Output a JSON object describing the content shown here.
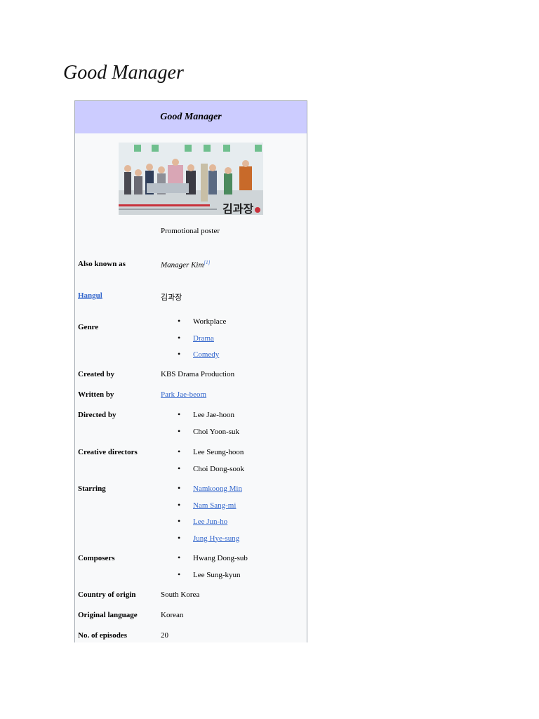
{
  "page": {
    "title": "Good Manager"
  },
  "infobox": {
    "header": "Good Manager",
    "poster_caption": "Promotional poster",
    "poster_logo_text": "김과장",
    "rows": {
      "also_known_as": {
        "label": "Also known as",
        "value": "Manager Kim",
        "ref": "[1]"
      },
      "hangul": {
        "label": "Hangul",
        "value": "김과장"
      },
      "genre": {
        "label": "Genre",
        "items": [
          "Workplace",
          "Drama",
          "Comedy"
        ]
      },
      "created_by": {
        "label": "Created by",
        "value": "KBS Drama Production"
      },
      "written_by": {
        "label": "Written by",
        "value": "Park Jae-beom"
      },
      "directed_by": {
        "label": "Directed by",
        "items": [
          "Lee Jae-hoon",
          "Choi Yoon-suk"
        ]
      },
      "creative_directors": {
        "label": "Creative directors",
        "items": [
          "Lee Seung-hoon",
          "Choi Dong-sook"
        ]
      },
      "starring": {
        "label": "Starring",
        "items": [
          "Namkoong Min",
          "Nam Sang-mi",
          "Lee Jun-ho",
          "Jung Hye-sung"
        ]
      },
      "composers": {
        "label": "Composers",
        "items": [
          "Hwang Dong-sub",
          "Lee Sung-kyun"
        ]
      },
      "country": {
        "label": "Country of origin",
        "value": "South Korea"
      },
      "language": {
        "label": "Original language",
        "value": "Korean"
      },
      "episodes": {
        "label": "No. of episodes",
        "value": "20"
      }
    }
  },
  "colors": {
    "header_bg": "#ccccff",
    "link": "#3366cc",
    "infobox_bg": "#f8f9fa",
    "border": "#a2a9b1"
  }
}
